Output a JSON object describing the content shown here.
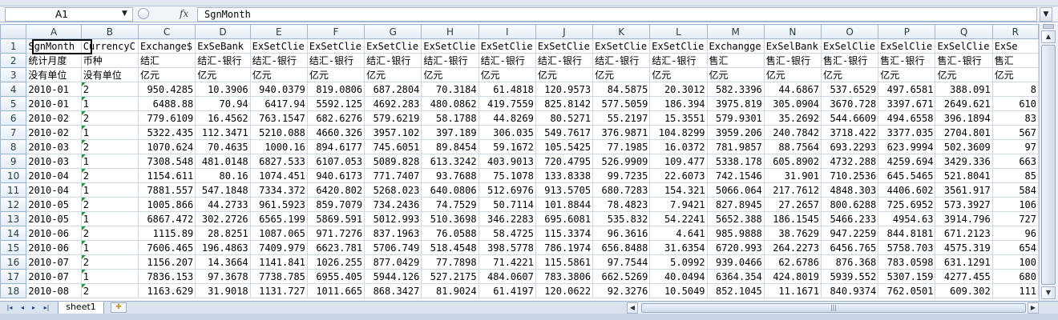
{
  "formula_bar": {
    "name_box": "A1",
    "fx_label": "fx",
    "formula_value": "SgnMonth"
  },
  "sheet": {
    "columns": [
      "A",
      "B",
      "C",
      "D",
      "E",
      "F",
      "G",
      "H",
      "I",
      "J",
      "K",
      "L",
      "M",
      "N",
      "O",
      "P",
      "Q",
      "R"
    ],
    "rows": [
      {
        "n": "1",
        "cells": [
          "SgnMonth",
          "CurrencyC",
          "Exchange$",
          "ExSeBank",
          "ExSetClie",
          "ExSetClie",
          "ExSetClie",
          "ExSetClie",
          "ExSetClie",
          "ExSetClie",
          "ExSetClie",
          "ExSetClie",
          "Exchangge",
          "ExSelBank",
          "ExSelClie",
          "ExSelClie",
          "ExSelClie",
          "ExSe"
        ]
      },
      {
        "n": "2",
        "cells": [
          "统计月度",
          "币种",
          "结汇",
          "结汇-银行",
          "结汇-银行",
          "结汇-银行",
          "结汇-银行",
          "结汇-银行",
          "结汇-银行",
          "结汇-银行",
          "结汇-银行",
          "结汇-银行",
          "售汇",
          "售汇-银行",
          "售汇-银行",
          "售汇-银行",
          "售汇-银行",
          "售汇"
        ]
      },
      {
        "n": "3",
        "cells": [
          "没有单位",
          "没有单位",
          "亿元",
          "亿元",
          "亿元",
          "亿元",
          "亿元",
          "亿元",
          "亿元",
          "亿元",
          "亿元",
          "亿元",
          "亿元",
          "亿元",
          "亿元",
          "亿元",
          "亿元",
          "亿元"
        ]
      },
      {
        "n": "4",
        "cells": [
          "2010-01",
          "2",
          "950.4285",
          "10.3906",
          "940.0379",
          "819.0806",
          "687.2804",
          "70.3184",
          "61.4818",
          "120.9573",
          "84.5875",
          "20.3012",
          "582.3396",
          "44.6867",
          "537.6529",
          "497.6581",
          "388.091",
          "8"
        ]
      },
      {
        "n": "5",
        "cells": [
          "2010-01",
          "1",
          "6488.88",
          "70.94",
          "6417.94",
          "5592.125",
          "4692.283",
          "480.0862",
          "419.7559",
          "825.8142",
          "577.5059",
          "186.394",
          "3975.819",
          "305.0904",
          "3670.728",
          "3397.671",
          "2649.621",
          "610"
        ]
      },
      {
        "n": "6",
        "cells": [
          "2010-02",
          "2",
          "779.6109",
          "16.4562",
          "763.1547",
          "682.6276",
          "579.6219",
          "58.1788",
          "44.8269",
          "80.5271",
          "55.2197",
          "15.3551",
          "579.9301",
          "35.2692",
          "544.6609",
          "494.6558",
          "396.1894",
          "83"
        ]
      },
      {
        "n": "7",
        "cells": [
          "2010-02",
          "1",
          "5322.435",
          "112.3471",
          "5210.088",
          "4660.326",
          "3957.102",
          "397.189",
          "306.035",
          "549.7617",
          "376.9871",
          "104.8299",
          "3959.206",
          "240.7842",
          "3718.422",
          "3377.035",
          "2704.801",
          "567"
        ]
      },
      {
        "n": "8",
        "cells": [
          "2010-03",
          "2",
          "1070.624",
          "70.4635",
          "1000.16",
          "894.6177",
          "745.6051",
          "89.8454",
          "59.1672",
          "105.5425",
          "77.1985",
          "16.0372",
          "781.9857",
          "88.7564",
          "693.2293",
          "623.9994",
          "502.3609",
          "97"
        ]
      },
      {
        "n": "9",
        "cells": [
          "2010-03",
          "1",
          "7308.548",
          "481.0148",
          "6827.533",
          "6107.053",
          "5089.828",
          "613.3242",
          "403.9013",
          "720.4795",
          "526.9909",
          "109.477",
          "5338.178",
          "605.8902",
          "4732.288",
          "4259.694",
          "3429.336",
          "663"
        ]
      },
      {
        "n": "10",
        "cells": [
          "2010-04",
          "2",
          "1154.611",
          "80.16",
          "1074.451",
          "940.6173",
          "771.7407",
          "93.7688",
          "75.1078",
          "133.8338",
          "99.7235",
          "22.6073",
          "742.1546",
          "31.901",
          "710.2536",
          "645.5465",
          "521.8041",
          "85"
        ]
      },
      {
        "n": "11",
        "cells": [
          "2010-04",
          "1",
          "7881.557",
          "547.1848",
          "7334.372",
          "6420.802",
          "5268.023",
          "640.0806",
          "512.6976",
          "913.5705",
          "680.7283",
          "154.321",
          "5066.064",
          "217.7612",
          "4848.303",
          "4406.602",
          "3561.917",
          "584"
        ]
      },
      {
        "n": "12",
        "cells": [
          "2010-05",
          "2",
          "1005.866",
          "44.2733",
          "961.5923",
          "859.7079",
          "734.2436",
          "74.7529",
          "50.7114",
          "101.8844",
          "78.4823",
          "7.9421",
          "827.8945",
          "27.2657",
          "800.6288",
          "725.6952",
          "573.3927",
          "106"
        ]
      },
      {
        "n": "13",
        "cells": [
          "2010-05",
          "1",
          "6867.472",
          "302.2726",
          "6565.199",
          "5869.591",
          "5012.993",
          "510.3698",
          "346.2283",
          "695.6081",
          "535.832",
          "54.2241",
          "5652.388",
          "186.1545",
          "5466.233",
          "4954.63",
          "3914.796",
          "727"
        ]
      },
      {
        "n": "14",
        "cells": [
          "2010-06",
          "2",
          "1115.89",
          "28.8251",
          "1087.065",
          "971.7276",
          "837.1963",
          "76.0588",
          "58.4725",
          "115.3374",
          "96.3616",
          "4.641",
          "985.9888",
          "38.7629",
          "947.2259",
          "844.8181",
          "671.2123",
          "96"
        ]
      },
      {
        "n": "15",
        "cells": [
          "2010-06",
          "1",
          "7606.465",
          "196.4863",
          "7409.979",
          "6623.781",
          "5706.749",
          "518.4548",
          "398.5778",
          "786.1974",
          "656.8488",
          "31.6354",
          "6720.993",
          "264.2273",
          "6456.765",
          "5758.703",
          "4575.319",
          "654"
        ]
      },
      {
        "n": "16",
        "cells": [
          "2010-07",
          "2",
          "1156.207",
          "14.3664",
          "1141.841",
          "1026.255",
          "877.0429",
          "77.7898",
          "71.4221",
          "115.5861",
          "97.7544",
          "5.0992",
          "939.0466",
          "62.6786",
          "876.368",
          "783.0598",
          "631.1291",
          "100"
        ]
      },
      {
        "n": "17",
        "cells": [
          "2010-07",
          "1",
          "7836.153",
          "97.3678",
          "7738.785",
          "6955.405",
          "5944.126",
          "527.2175",
          "484.0607",
          "783.3806",
          "662.5269",
          "40.0494",
          "6364.354",
          "424.8019",
          "5939.552",
          "5307.159",
          "4277.455",
          "680"
        ]
      },
      {
        "n": "18",
        "cells": [
          "2010-08",
          "2",
          "1163.629",
          "31.9018",
          "1131.727",
          "1011.665",
          "868.3427",
          "81.9024",
          "61.4197",
          "120.0622",
          "92.3276",
          "10.5049",
          "852.1045",
          "11.1671",
          "840.9374",
          "762.0501",
          "609.302",
          "111"
        ]
      }
    ]
  },
  "tabs": {
    "sheet_tab": "sheet1",
    "nav": [
      "|◂",
      "◂",
      "▸",
      "▸|"
    ]
  }
}
